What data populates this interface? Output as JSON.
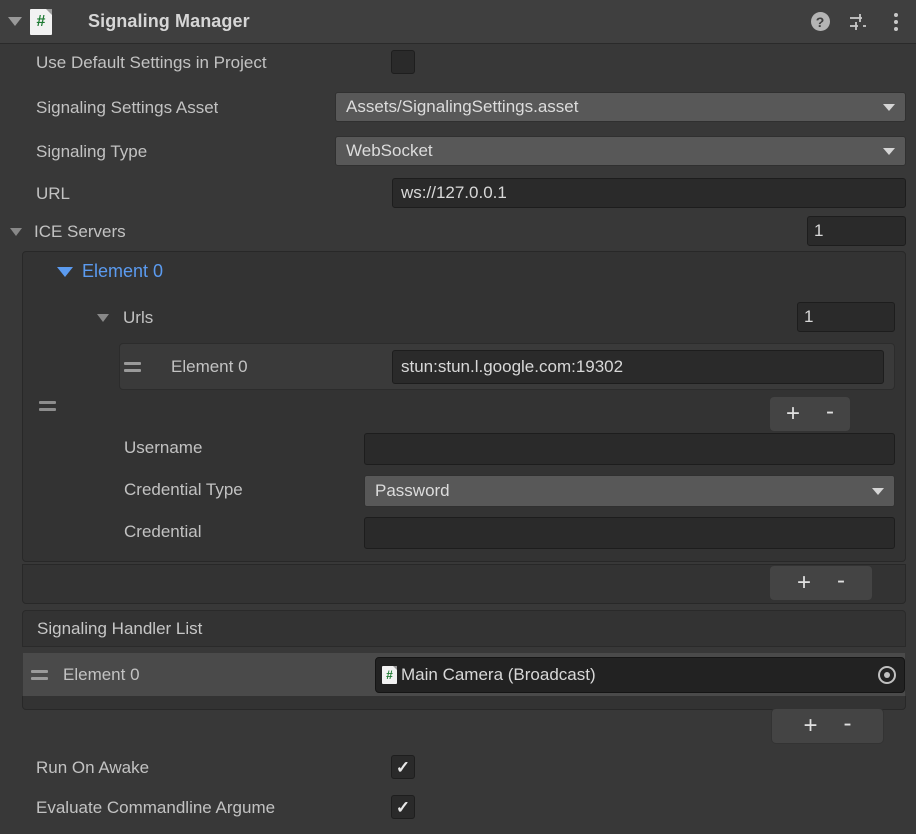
{
  "header": {
    "title": "Signaling Manager",
    "script_icon": "csharp-script-icon",
    "glyph": "#",
    "foldout_expanded": true,
    "help_icon": "help-icon",
    "help_glyph": "?",
    "preset_icon": "preset-settings-icon",
    "menu_icon": "kebab-menu-icon"
  },
  "fields": {
    "use_default_settings": {
      "label": "Use Default Settings in Project",
      "checked": false,
      "check_glyph": ""
    },
    "signaling_settings_asset": {
      "label": "Signaling Settings Asset",
      "value": "Assets/SignalingSettings.asset"
    },
    "signaling_type": {
      "label": "Signaling Type",
      "value": "WebSocket"
    },
    "url": {
      "label": "URL",
      "value": "ws://127.0.0.1"
    },
    "run_on_awake": {
      "label": "Run On Awake",
      "checked": true,
      "check_glyph": "✓"
    },
    "evaluate_commandline": {
      "label": "Evaluate Commandline Argume",
      "checked": true,
      "check_glyph": "✓"
    }
  },
  "ice_servers": {
    "label": "ICE Servers",
    "size": "1",
    "expanded": true,
    "element": {
      "label": "Element 0",
      "expanded": true,
      "urls": {
        "label": "Urls",
        "size": "1",
        "expanded": true,
        "items": [
          {
            "label": "Element 0",
            "value": "stun:stun.l.google.com:19302"
          }
        ]
      },
      "username": {
        "label": "Username",
        "value": ""
      },
      "credential_type": {
        "label": "Credential Type",
        "value": "Password"
      },
      "credential": {
        "label": "Credential",
        "value": ""
      }
    },
    "urls_add": "+",
    "urls_remove": "-",
    "list_add": "+",
    "list_remove": "-"
  },
  "signaling_handler_list": {
    "label": "Signaling Handler List",
    "items": [
      {
        "label": "Element 0",
        "value": "Main Camera (Broadcast)",
        "icon": "csharp-script-icon",
        "glyph": "#"
      }
    ],
    "add": "+",
    "remove": "-"
  },
  "colors": {
    "background": "#383838",
    "header_bg": "#3f3f3f",
    "element_blue": "#5b9bf0",
    "script_green": "#1d7a32",
    "text": "#c2c2c2"
  }
}
